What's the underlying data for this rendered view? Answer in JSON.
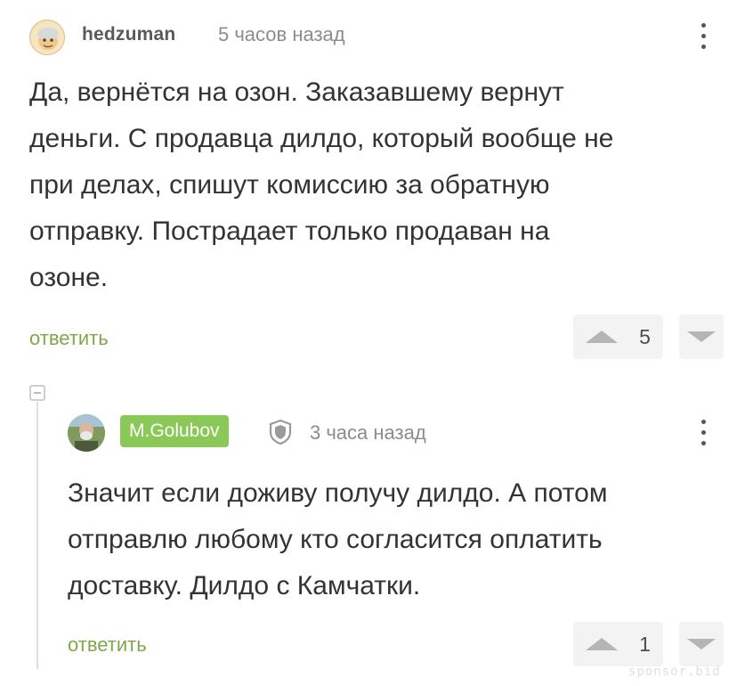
{
  "comments": [
    {
      "author": "hedzuman",
      "time": "5 часов назад",
      "text_lines": [
        "Да, вернётся на озон. Заказавшему вернут",
        "деньги. С продавца дилдо, который вообще не",
        "при делах, спишут комиссию за обратную",
        "отправку. Пострадает только продаван на",
        "озоне."
      ],
      "reply_label": "ответить",
      "rating": "5"
    },
    {
      "author": "M.Golubov",
      "time": "3 часа назад",
      "text_lines": [
        "Значит если доживу получу дилдо. А потом",
        "отправлю любому кто согласится оплатить",
        "доставку. Дилдо с Камчатки."
      ],
      "reply_label": "ответить",
      "rating": "1"
    }
  ],
  "watermark": "sponsor.bid",
  "colors": {
    "reply_link": "#7ea84a",
    "username_badge": "#8ac858",
    "text": "#333333",
    "meta": "#8c8c8c"
  },
  "icons": [
    "avatar-hedzuman",
    "avatar-golubov",
    "shield-icon",
    "menu-dots-icon",
    "arrow-up-icon",
    "arrow-down-icon",
    "collapse-minus-icon"
  ]
}
